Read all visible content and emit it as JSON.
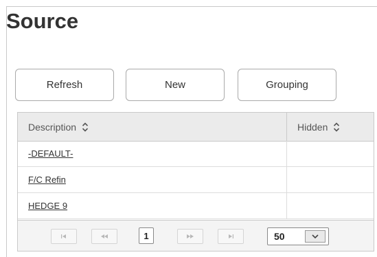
{
  "page": {
    "title": "Source"
  },
  "toolbar": {
    "refresh_label": "Refresh",
    "new_label": "New",
    "grouping_label": "Grouping"
  },
  "grid": {
    "columns": [
      {
        "label": "Description"
      },
      {
        "label": "Hidden"
      }
    ],
    "rows": [
      {
        "description": "-DEFAULT-",
        "hidden": ""
      },
      {
        "description": "F/C Refin",
        "hidden": ""
      },
      {
        "description": "HEDGE 9",
        "hidden": ""
      }
    ]
  },
  "pager": {
    "first_icon": "first-page-icon",
    "prev_icon": "previous-page-icon",
    "next_icon": "next-page-icon",
    "last_icon": "last-page-icon",
    "current_page": "1",
    "page_size": "50"
  },
  "colors": {
    "header_bg": "#ebebeb",
    "border": "#c9c9c9",
    "pager_bg": "#f4f4f4"
  }
}
